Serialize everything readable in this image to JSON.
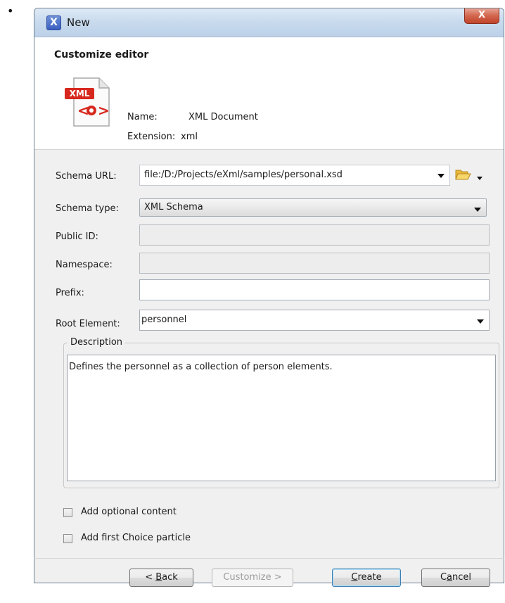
{
  "window": {
    "title": "New",
    "close_symbol": "X"
  },
  "header": {
    "title": "Customize editor",
    "badge": "XML",
    "name_label": "Name:",
    "name_value": "XML Document",
    "extension_label": "Extension:",
    "extension_value": "xml"
  },
  "form": {
    "schema_url": {
      "label": "Schema URL:",
      "value": "file:/D:/Projects/eXml/samples/personal.xsd"
    },
    "schema_type": {
      "label": "Schema type:",
      "value": "XML Schema"
    },
    "public_id": {
      "label": "Public ID:",
      "value": ""
    },
    "namespace": {
      "label": "Namespace:",
      "value": ""
    },
    "prefix": {
      "label": "Prefix:",
      "value": ""
    },
    "root_element": {
      "label": "Root Element:",
      "value": "personnel"
    }
  },
  "description": {
    "legend": "Description",
    "text": "Defines the personnel as a collection of person elements."
  },
  "options": {
    "add_optional_content": {
      "label": "Add optional content",
      "checked": false
    },
    "add_first_choice": {
      "label": "Add first Choice particle",
      "checked": false
    }
  },
  "buttons": {
    "back": {
      "prefix": "< ",
      "mnemonic": "B",
      "rest": "ack"
    },
    "customize": {
      "label": "Customize >"
    },
    "create": {
      "mnemonic": "C",
      "rest": "reate"
    },
    "cancel": {
      "prefix": "C",
      "mnemonic": "a",
      "rest": "ncel"
    }
  },
  "colors": {
    "titlebar": "#c9dbee",
    "close": "#c0442a",
    "xml_badge": "#d7281e",
    "folder": "#f1c44a"
  }
}
